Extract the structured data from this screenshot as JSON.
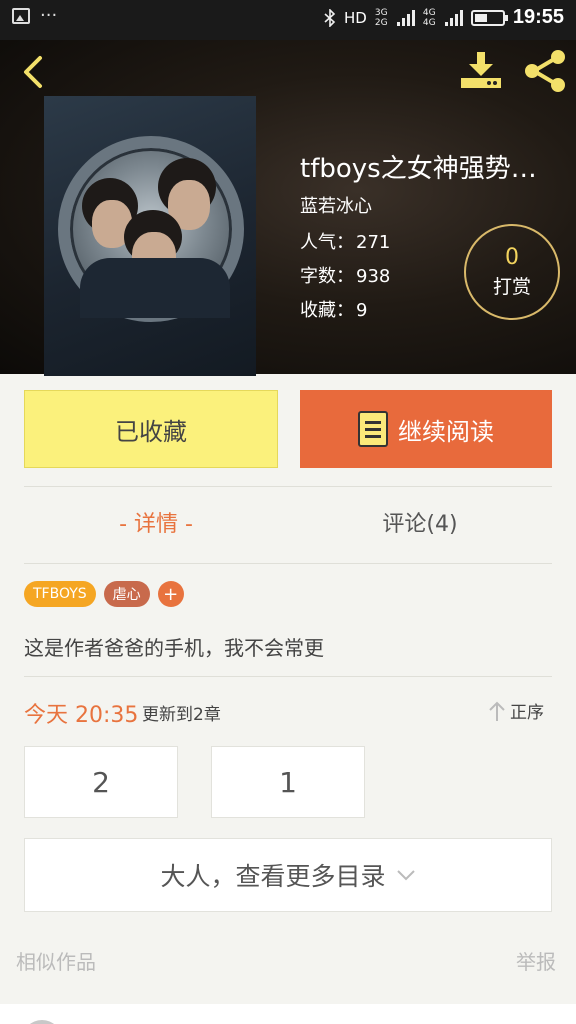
{
  "status_bar": {
    "network_type": "HD",
    "net_label_1": "3G 2G",
    "net_label_2": "4G 4G",
    "time": "19:55"
  },
  "header": {
    "book": {
      "title": "tfboys之女神强势…",
      "author": "蓝若冰心",
      "popularity_label": "人气：",
      "popularity": "271",
      "word_count_label": "字数：",
      "word_count": "938",
      "favorites_label": "收藏：",
      "favorites": "9"
    },
    "tip": {
      "count": "0",
      "label": "打赏"
    },
    "icons": {
      "back": "back-arrow-icon",
      "download": "download-icon",
      "share": "share-icon"
    }
  },
  "actions": {
    "favorite_label": "已收藏",
    "read_label": "继续阅读"
  },
  "tabs": {
    "detail": "- 详情 -",
    "comments": "评论(4)"
  },
  "tags": [
    "TFBOYS",
    "虐心"
  ],
  "tag_add": "+",
  "description": "这是作者爸爸的手机，我不会常更",
  "update": {
    "time": "今天 20:35",
    "text": "更新到2章",
    "sort_label": "正序"
  },
  "chapters": [
    "2",
    "1"
  ],
  "more_catalog_label": "大人，查看更多目录",
  "similar_label": "相似作品",
  "report_label": "举报",
  "colors": {
    "accent": "#e8733e",
    "favorite_bg": "#fbf17c",
    "read_bg": "#e86a3c",
    "tip_border": "#d9b96a"
  }
}
